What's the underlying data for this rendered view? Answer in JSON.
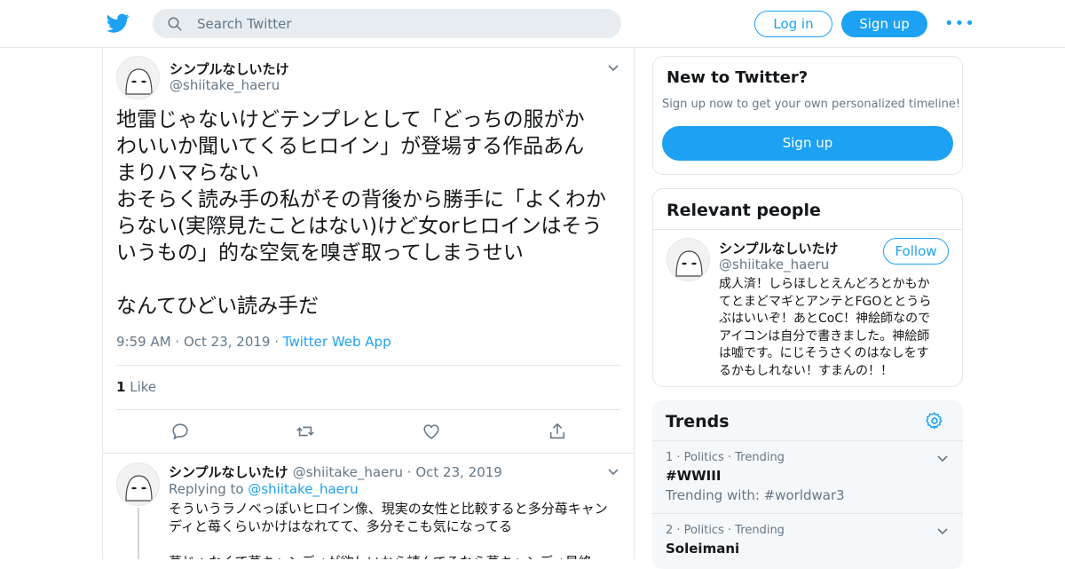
{
  "topbar": {
    "search_placeholder": "Search Twitter",
    "login_label": "Log in",
    "signup_label": "Sign up",
    "more_label": "•••"
  },
  "colors": {
    "accent": "#1da1f2",
    "secondary_text": "#657786",
    "border": "#e1e8ed",
    "trends_background": "#f5f8fa"
  },
  "tweet": {
    "author_name": "シンプルなしいたけ",
    "author_handle": "@shiitake_haeru",
    "text": "地雷じゃないけどテンプレとして「どっちの服がか\nわいいか聞いてくるヒロイン」が登場する作品あん\nまりハマらない\nおそらく読み手の私がその背後から勝手に「よくわか\nらない(実際見たことはない)けど女orヒロインはそう\nいうもの」的な空気を嗅ぎ取ってしまうせい\n\nなんてひどい読み手だ",
    "time": "9:59 AM",
    "date": "Oct 23, 2019",
    "source": "Twitter Web App",
    "like_count": "1",
    "like_label": "Like",
    "actions": [
      "reply-icon",
      "retweet-icon",
      "like-icon",
      "share-icon"
    ]
  },
  "reply": {
    "author_name": "シンプルなしいたけ",
    "author_handle": "@shiitake_haeru",
    "date": "Oct 23, 2019",
    "replying_to_label": "Replying to",
    "replying_to_handle": "@shiitake_haeru",
    "text": "そういうラノベっぽいヒロイン像、現実の女性と比較すると多分苺キャン\nディと苺くらいかけはなれてて、多分そこも気になってる\n\n苺じゃなくて苺キャンディが欲しいから読んでるなら苺キャンディ最終"
  },
  "new_to_twitter": {
    "title": "New to Twitter?",
    "subtitle": "Sign up now to get your own personalized timeline!",
    "button_label": "Sign up"
  },
  "relevant_people": {
    "title": "Relevant people",
    "person": {
      "name": "シンプルなしいたけ",
      "handle": "@shiitake_haeru",
      "follow_label": "Follow",
      "bio": "成人済！しらほしとえんどろとかもか\nてとまどマギとアンテとFGOととうら\nぶはいいぞ！あとCoC！神絵師なので\nアイコンは自分で書きました。神絵師\nは嘘です。にじそうさくのはなしをす\nるかもしれない！すまんの！！"
    }
  },
  "trends": {
    "title": "Trends",
    "items": [
      {
        "meta": "1 · Politics · Trending",
        "name": "#WWIII",
        "sub": "Trending with: #worldwar3"
      },
      {
        "meta": "2 · Politics · Trending",
        "name": "Soleimani",
        "sub": ""
      }
    ]
  }
}
